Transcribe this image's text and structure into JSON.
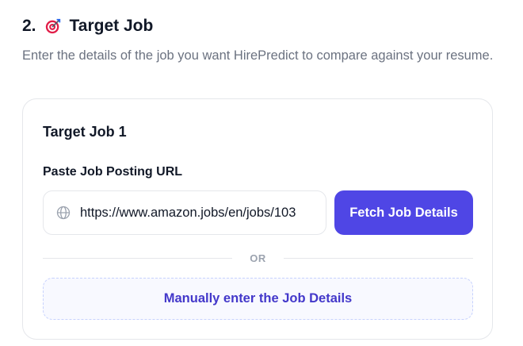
{
  "section": {
    "number": "2.",
    "icon": "target-icon",
    "title": "Target Job",
    "subtitle": "Enter the details of the job you want HirePredict to compare against your resume."
  },
  "job_card": {
    "title": "Target Job 1",
    "url_field": {
      "label": "Paste Job Posting URL",
      "icon": "globe-icon",
      "value": "https://www.amazon.jobs/en/jobs/103"
    },
    "fetch_button": "Fetch Job Details",
    "divider_text": "OR",
    "manual_button": "Manually enter the Job Details"
  },
  "colors": {
    "primary": "#4f46e5",
    "manual_text": "#4338ca",
    "subtitle": "#6b7280",
    "target_red": "#e11d48"
  }
}
